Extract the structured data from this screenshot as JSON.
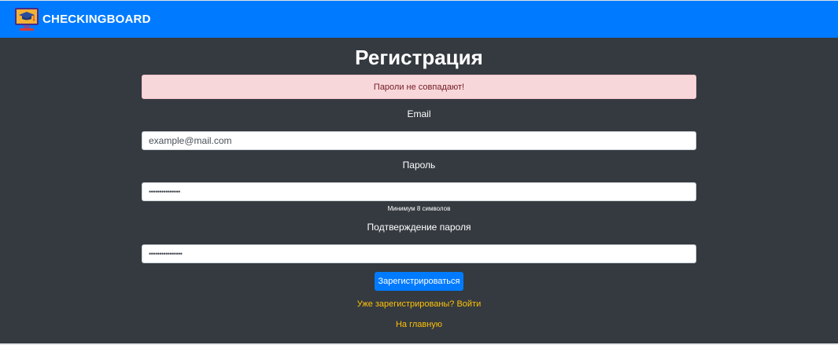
{
  "navbar": {
    "brand_text": "CHECKINGBOARD",
    "logo_icon": "graduation-cap-monitor-icon",
    "bg_color": "#007bff"
  },
  "page": {
    "title": "Регистрация",
    "bg_color": "#343a40"
  },
  "alert": {
    "text": "Пароли не совпадают!",
    "bg_color": "#f8d7da",
    "text_color": "#721c24"
  },
  "form": {
    "email_label": "Email",
    "email_value": "example@mail.com",
    "password_label": "Пароль",
    "password_value": "•••••••••••••••",
    "password_hint": "Минимум 8 символов",
    "confirm_label": "Подтверждение пароля",
    "confirm_value": "••••••••••••••••",
    "submit_label": "Зарегистрироваться"
  },
  "links": {
    "login_text": "Уже зарегистрированы? Войти",
    "home_text": "На главную",
    "color": "#ffc107"
  }
}
